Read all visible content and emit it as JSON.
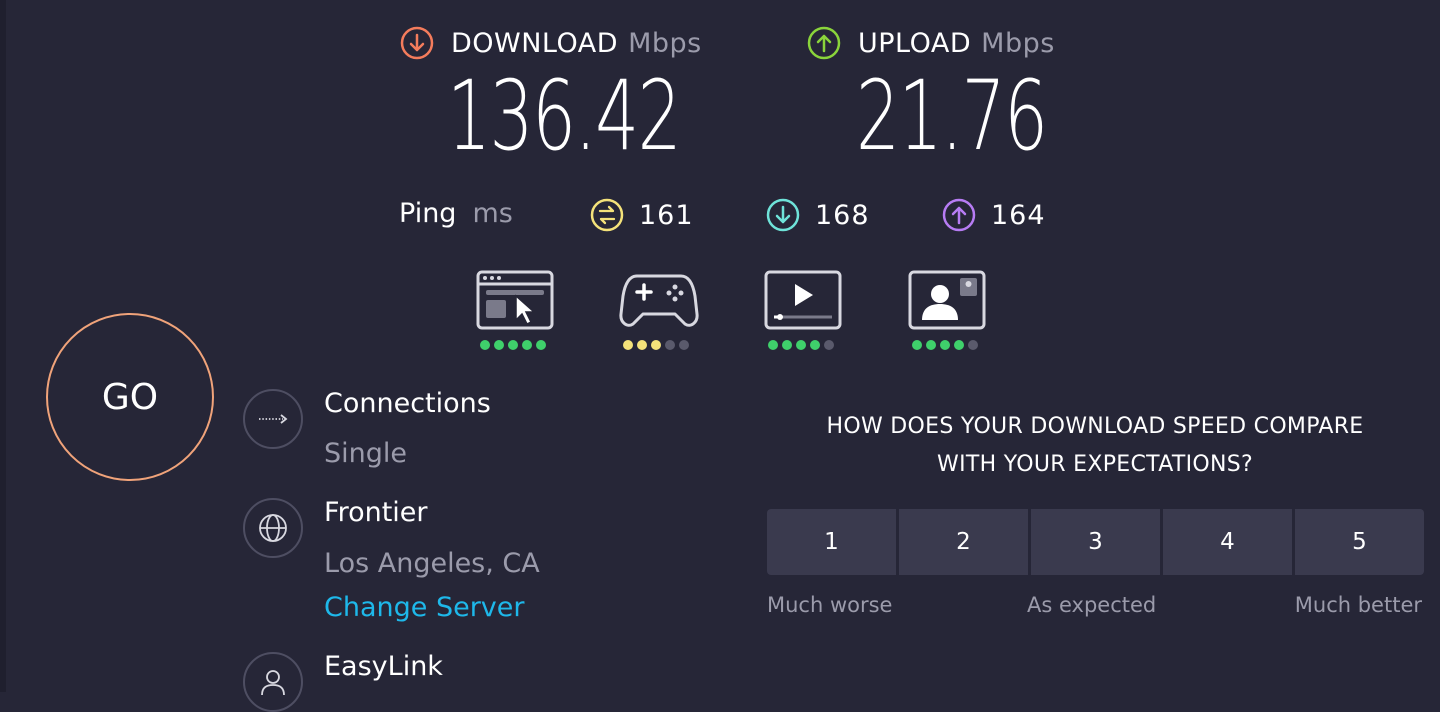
{
  "download": {
    "label": "DOWNLOAD",
    "unit": "Mbps",
    "value": "136.42",
    "color": "#f47c5c"
  },
  "upload": {
    "label": "UPLOAD",
    "unit": "Mbps",
    "value": "21.76",
    "color": "#8ad43b"
  },
  "ping": {
    "label": "Ping",
    "unit": "ms",
    "idle": {
      "value": "161",
      "color": "#f4e27a"
    },
    "download": {
      "value": "168",
      "color": "#6fe3d9"
    },
    "upload": {
      "value": "164",
      "color": "#b77cf4"
    }
  },
  "quality": [
    {
      "icon": "web-browsing-icon",
      "level": 5,
      "color": "#3fd06b"
    },
    {
      "icon": "gaming-icon",
      "level": 3,
      "color": "#f4e27a"
    },
    {
      "icon": "video-streaming-icon",
      "level": 4,
      "color": "#3fd06b"
    },
    {
      "icon": "video-chat-icon",
      "level": 4,
      "color": "#3fd06b"
    }
  ],
  "go_button": {
    "label": "GO"
  },
  "connections": {
    "title": "Connections",
    "value": "Single"
  },
  "server": {
    "provider": "Frontier",
    "location": "Los Angeles, CA",
    "change_label": "Change Server"
  },
  "host": {
    "title": "EasyLink"
  },
  "survey": {
    "question_line1": "HOW DOES YOUR DOWNLOAD SPEED COMPARE",
    "question_line2": "WITH YOUR EXPECTATIONS?",
    "options": [
      "1",
      "2",
      "3",
      "4",
      "5"
    ],
    "scale_low": "Much worse",
    "scale_mid": "As expected",
    "scale_high": "Much better"
  }
}
